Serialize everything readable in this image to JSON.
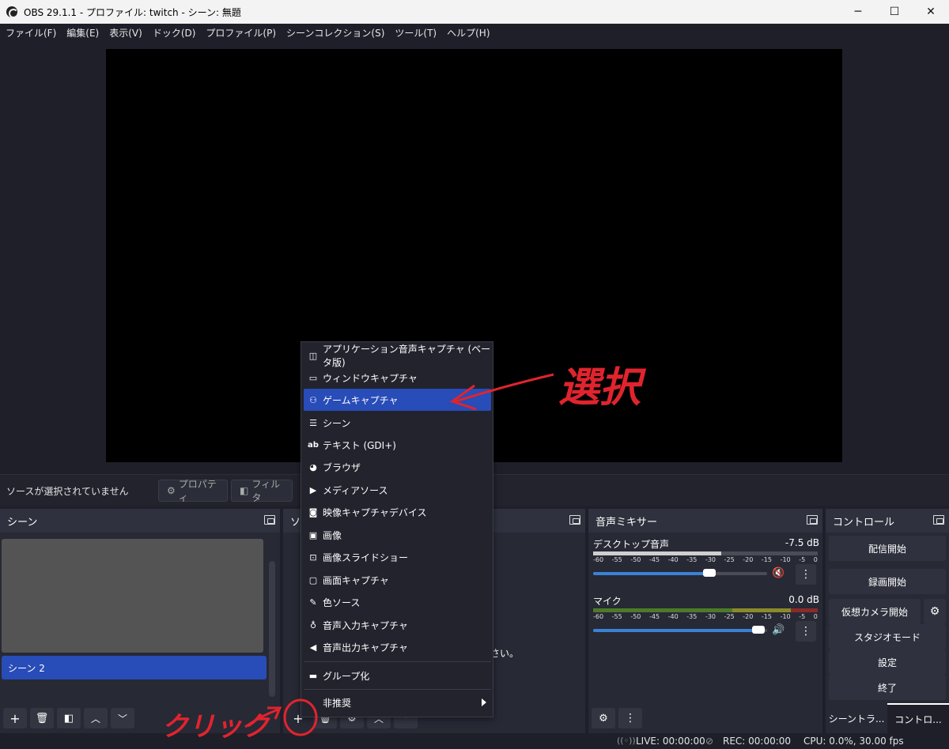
{
  "window": {
    "title": "OBS 29.1.1 - プロファイル: twitch - シーン: 無題",
    "minimize": "─",
    "maximize": "☐",
    "close": "✕"
  },
  "menubar": [
    "ファイル(F)",
    "編集(E)",
    "表示(V)",
    "ドック(D)",
    "プロファイル(P)",
    "シーンコレクション(S)",
    "ツール(T)",
    "ヘルプ(H)"
  ],
  "context_bar": {
    "no_selection": "ソースが選択されていません",
    "properties": "プロパティ",
    "filters": "フィルタ"
  },
  "scenes": {
    "header": "シーン",
    "selected_item": "シーン 2"
  },
  "sources": {
    "header": "ソ",
    "hint_fragment": "さい。"
  },
  "mixer": {
    "header": "音声ミキサー",
    "scale": [
      "-60",
      "-55",
      "-50",
      "-45",
      "-40",
      "-35",
      "-30",
      "-25",
      "-20",
      "-15",
      "-10",
      "-5",
      "0"
    ],
    "channels": [
      {
        "name": "デスクトップ音声",
        "db": "-7.5 dB",
        "meter_level": 0.57,
        "fader": 0.67,
        "muted": true
      },
      {
        "name": "マイク",
        "db": "0.0 dB",
        "meter_level": 0.0,
        "fader": 0.95,
        "muted": false
      }
    ]
  },
  "controls": {
    "header": "コントロール",
    "start_streaming": "配信開始",
    "start_recording": "録画開始",
    "start_virtual_camera": "仮想カメラ開始",
    "studio_mode": "スタジオモード",
    "settings": "設定",
    "exit": "終了"
  },
  "tabs": [
    "シーントラ...",
    "コントロ..."
  ],
  "status": {
    "live": "LIVE: 00:00:00",
    "rec": "REC: 00:00:00",
    "cpu": "CPU: 0.0%, 30.00 fps"
  },
  "add_source_menu": {
    "items": [
      {
        "label": "アプリケーション音声キャプチャ (ベータ版)",
        "icon": "app-audio-icon"
      },
      {
        "label": "ウィンドウキャプチャ",
        "icon": "window-icon"
      },
      {
        "label": "ゲームキャプチャ",
        "icon": "gamepad-icon",
        "highlighted": true
      },
      {
        "label": "シーン",
        "icon": "list-icon"
      },
      {
        "label": "テキスト (GDI+)",
        "icon": "text-icon"
      },
      {
        "label": "ブラウザ",
        "icon": "globe-icon"
      },
      {
        "label": "メディアソース",
        "icon": "play-icon"
      },
      {
        "label": "映像キャプチャデバイス",
        "icon": "camera-icon"
      },
      {
        "label": "画像",
        "icon": "image-icon"
      },
      {
        "label": "画像スライドショー",
        "icon": "slideshow-icon"
      },
      {
        "label": "画面キャプチャ",
        "icon": "monitor-icon"
      },
      {
        "label": "色ソース",
        "icon": "brush-icon"
      },
      {
        "label": "音声入力キャプチャ",
        "icon": "mic-icon"
      },
      {
        "label": "音声出力キャプチャ",
        "icon": "speaker-icon"
      }
    ],
    "group": "グループ化",
    "deprecated": "非推奨"
  },
  "annotations": {
    "select": "選択",
    "click": "クリック"
  },
  "colors": {
    "accent": "#284cb8",
    "annotation": "#e0242e",
    "background": "#1e1f29"
  }
}
